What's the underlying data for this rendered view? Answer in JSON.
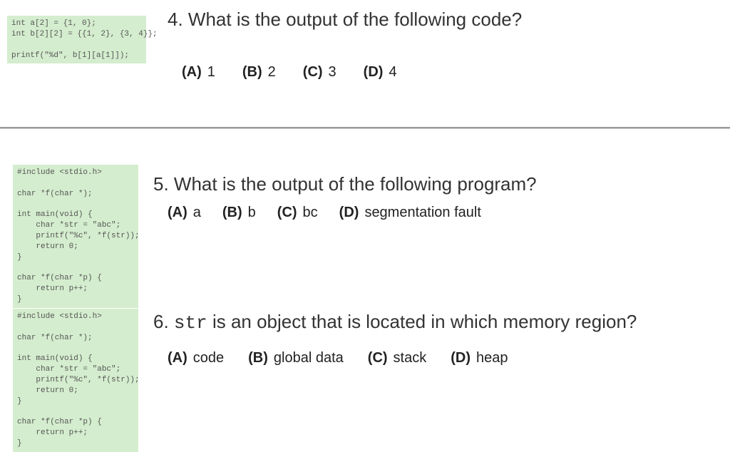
{
  "q4": {
    "code": "int a[2] = {1, 0};\nint b[2][2] = {{1, 2}, {3, 4}};\n\nprintf(\"%d\", b[1][a[1]]);",
    "question": "4. What is the output of the following code?",
    "answers": [
      {
        "letter": "(A)",
        "text": "1"
      },
      {
        "letter": "(B)",
        "text": "2"
      },
      {
        "letter": "(C)",
        "text": "3"
      },
      {
        "letter": "(D)",
        "text": "4"
      }
    ]
  },
  "q5": {
    "code": "#include <stdio.h>\n\nchar *f(char *);\n\nint main(void) {\n    char *str = \"abc\";\n    printf(\"%c\", *f(str));\n    return 0;\n}\n\nchar *f(char *p) {\n    return p++;\n}",
    "question": "5. What is the output of the following program?",
    "answers": [
      {
        "letter": "(A)",
        "text": "a"
      },
      {
        "letter": "(B)",
        "text": "b"
      },
      {
        "letter": "(C)",
        "text": "bc"
      },
      {
        "letter": "(D)",
        "text": "segmentation fault"
      }
    ]
  },
  "q6": {
    "code": "#include <stdio.h>\n\nchar *f(char *);\n\nint main(void) {\n    char *str = \"abc\";\n    printf(\"%c\", *f(str));\n    return 0;\n}\n\nchar *f(char *p) {\n    return p++;\n}",
    "question_pre": "6. ",
    "question_mono": "str",
    "question_post": "  is an object that is located in which memory region?",
    "answers": [
      {
        "letter": "(A)",
        "text": "code"
      },
      {
        "letter": "(B)",
        "text": "global data"
      },
      {
        "letter": "(C)",
        "text": "stack"
      },
      {
        "letter": "(D)",
        "text": "heap"
      }
    ]
  }
}
